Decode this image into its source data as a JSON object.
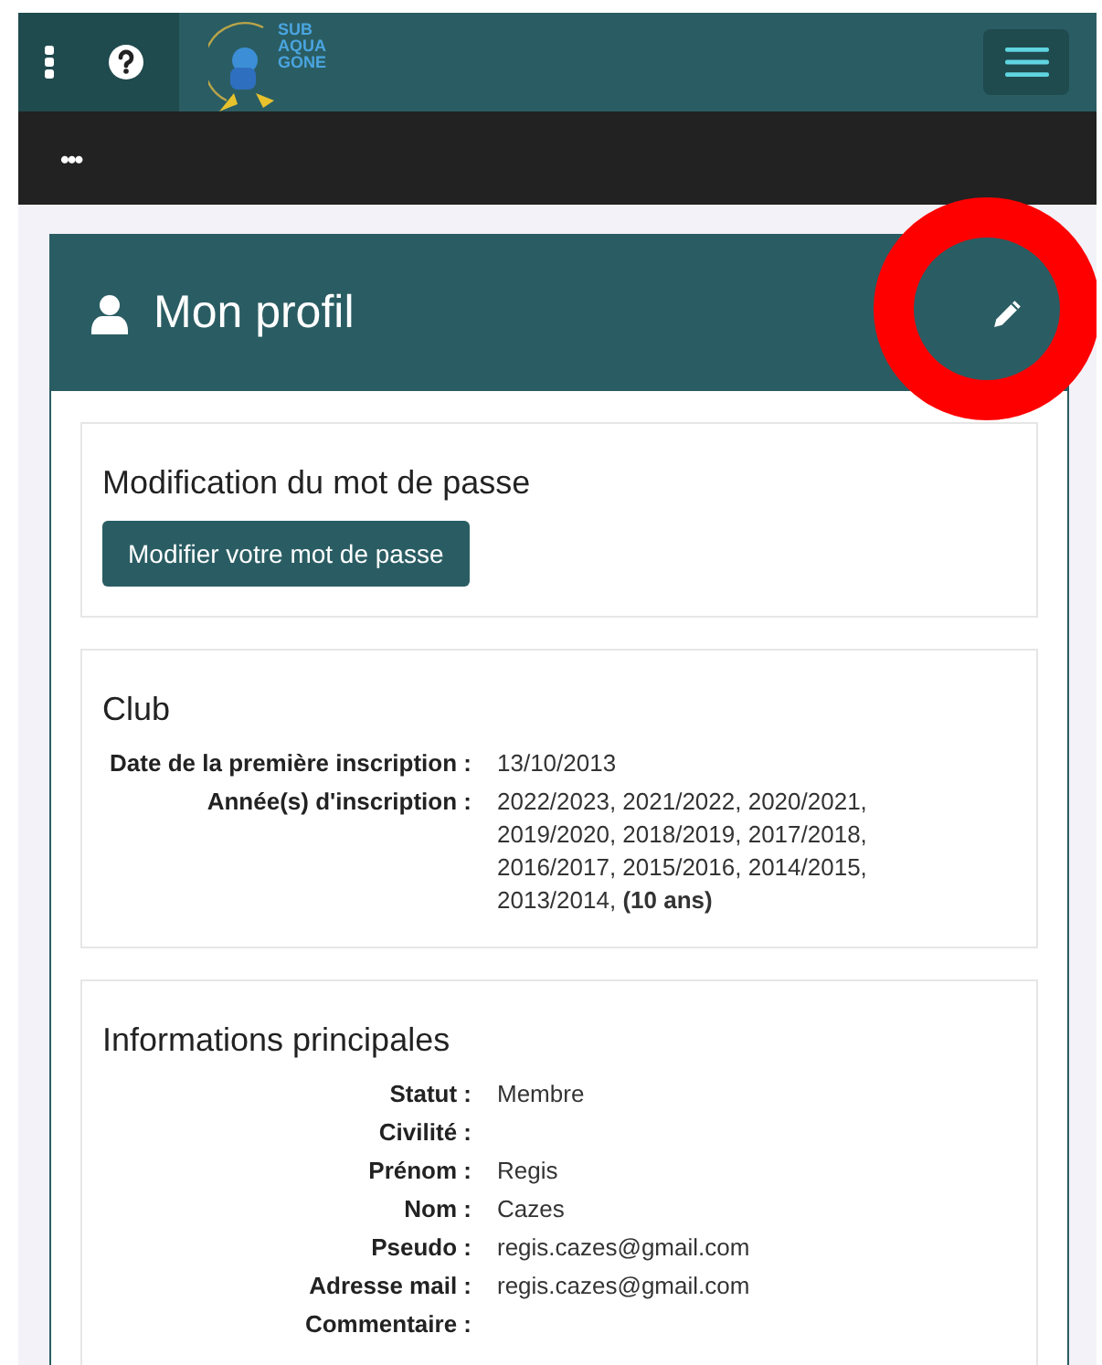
{
  "topbar": {
    "logo_lines": [
      "SUB",
      "AQUA",
      "GONE"
    ]
  },
  "subbar": {
    "label": "•••"
  },
  "card": {
    "title": "Mon profil",
    "sections": [
      {
        "kind": "action",
        "title": "Modification du mot de passe",
        "button": "Modifier votre mot de passe"
      },
      {
        "kind": "fields",
        "title": "Club",
        "rows": [
          {
            "label": "Date de la première inscription :",
            "value": "13/10/2013"
          },
          {
            "label": "Année(s) d'inscription :",
            "value": "2022/2023, 2021/2022, 2020/2021, 2019/2020, 2018/2019, 2017/2018, 2016/2017, 2015/2016, 2014/2015, 2013/2014, **(10 ans)**"
          }
        ]
      },
      {
        "kind": "fields",
        "title": "Informations principales",
        "rows": [
          {
            "label": "Statut :",
            "value": "Membre"
          },
          {
            "label": "Civilité :"
          },
          {
            "label": "Prénom :",
            "value": "Regis"
          },
          {
            "label": "Nom :",
            "value": "Cazes"
          },
          {
            "label": "Pseudo :",
            "value": "regis.cazes@gmail.com"
          },
          {
            "label": "Adresse mail :",
            "value": "regis.cazes@gmail.com"
          },
          {
            "label": "Commentaire :"
          }
        ]
      }
    ]
  }
}
